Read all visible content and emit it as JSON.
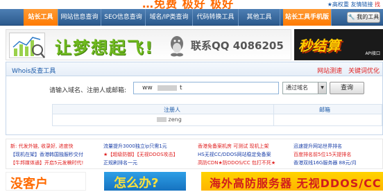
{
  "top": {
    "promo": "…免费 极好 极好",
    "right_links": [
      "★高权重",
      "友情链接"
    ],
    "right_hot": "找"
  },
  "nav": {
    "items": [
      "站长工具",
      "网站信息查询",
      "SEO信息查询",
      "域名/IP类查询",
      "代码转换工具",
      "其他工具"
    ],
    "mobile": "站长工具手机版",
    "my_tools": "我的工具"
  },
  "banner": {
    "slogan": "让梦想起飞!",
    "qq_label": "联系QQ 4086205"
  },
  "ad_right": {
    "title": "秒结算",
    "sub": "API接口"
  },
  "whois": {
    "title": "Whois反查工具",
    "links": [
      "网站测速",
      "关键词优化"
    ],
    "form_label": "请输入域名、注册人或邮箱:",
    "input_prefix": "ww",
    "input_suffix": "t",
    "select_value": "通过域名",
    "query_button": "查询"
  },
  "result": {
    "headers": [
      "注册人",
      "邮箱"
    ],
    "rows": [
      {
        "registrant_suffix": "zeng",
        "email": ""
      }
    ]
  },
  "ads": {
    "col1": [
      {
        "text": "新: 代发外链, 收录好, 进度快",
        "color": "red"
      },
      {
        "text": "【现机在架】香港韩国独服秒交付",
        "color": "blue"
      },
      {
        "text": "【牛邦媒体通】开启5元发稿时代!",
        "color": "red"
      }
    ],
    "col2": [
      {
        "text": "流量提升3000独立ip只需1元",
        "color": "blue"
      },
      {
        "text": "★【超级防御】【无视DDOS攻击】",
        "color": "red"
      },
      {
        "text": "正规刷排名一元",
        "color": "blue"
      }
    ],
    "col3": [
      {
        "text": "香港免备案机房 可测试 现机上架",
        "color": "red"
      },
      {
        "text": "HS无视CC/DDOS网站稳定免备案",
        "color": "blue"
      },
      {
        "text": "高防CDN★防DDOS/CC 包打不死★",
        "color": "red"
      }
    ],
    "col4": [
      {
        "text": "迅速提升网站世界排名",
        "color": "blue"
      },
      {
        "text": "百度排名前5位15天提排名",
        "color": "red"
      },
      {
        "text": "香港双线16G服务器 88元/月",
        "color": "blue"
      }
    ]
  },
  "bottom": {
    "b1": "没客户",
    "b2": "怎么办?",
    "b3": "海外高防服务器 无视DDOS/CC"
  }
}
